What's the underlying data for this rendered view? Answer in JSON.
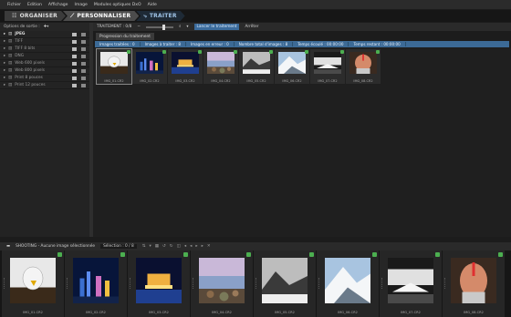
{
  "menu": [
    "Fichier",
    "Edition",
    "Affichage",
    "Image",
    "Modules optiques DxO",
    "Aide"
  ],
  "tabs": {
    "organiser": "ORGANISER",
    "personnaliser": "PERSONNALISER",
    "traiter": "TRAITER"
  },
  "left": {
    "options_label": "Options de sortie :",
    "tree": [
      "JPEG",
      "TIFF",
      "TIFF 8 bits",
      "DNG",
      "Web 600 pixels",
      "Web 800 pixels",
      "Print 8 pouces",
      "Print 12 pouces"
    ]
  },
  "toolbar": {
    "processing": "TRAITEMENT : 0/8",
    "start": "Lancer le traitement",
    "stop": "Arrêter"
  },
  "progress": {
    "tab": "Progression du traitement",
    "stats": [
      "Images traitées : 0",
      "Images à traiter : 8",
      "Images en erreur : 0",
      "Nombre total d'images : 8",
      "Temps écoulé : 00:00:00",
      "Temps restant : 00:00:00"
    ]
  },
  "processing_items": [
    {
      "name": "IMG_01.CR2",
      "kind": "eagle"
    },
    {
      "name": "IMG_02.CR2",
      "kind": "city"
    },
    {
      "name": "IMG_03.CR2",
      "kind": "night"
    },
    {
      "name": "IMG_04.CR2",
      "kind": "rocks"
    },
    {
      "name": "IMG_05.CR2",
      "kind": "bw"
    },
    {
      "name": "IMG_06.CR2",
      "kind": "mountain"
    },
    {
      "name": "IMG_07.CR2",
      "kind": "shore"
    },
    {
      "name": "IMG_08.CR2",
      "kind": "face"
    }
  ],
  "bottom": {
    "source": "SHOOTING - Aucune image sélectionnée",
    "selection": "Sélection : 0 / 8"
  },
  "filmstrip": [
    {
      "name": "IMG_01.CR2",
      "kind": "eagle"
    },
    {
      "name": "IMG_02.CR2",
      "kind": "city"
    },
    {
      "name": "IMG_03.CR2",
      "kind": "night"
    },
    {
      "name": "IMG_04.CR2",
      "kind": "rocks"
    },
    {
      "name": "IMG_05.CR2",
      "kind": "bw"
    },
    {
      "name": "IMG_06.CR2",
      "kind": "mountain"
    },
    {
      "name": "IMG_07.CR2",
      "kind": "shore"
    },
    {
      "name": "IMG_08.CR2",
      "kind": "face"
    }
  ],
  "colors": {
    "accent": "#3c6a96",
    "badge": "#4caf50"
  }
}
